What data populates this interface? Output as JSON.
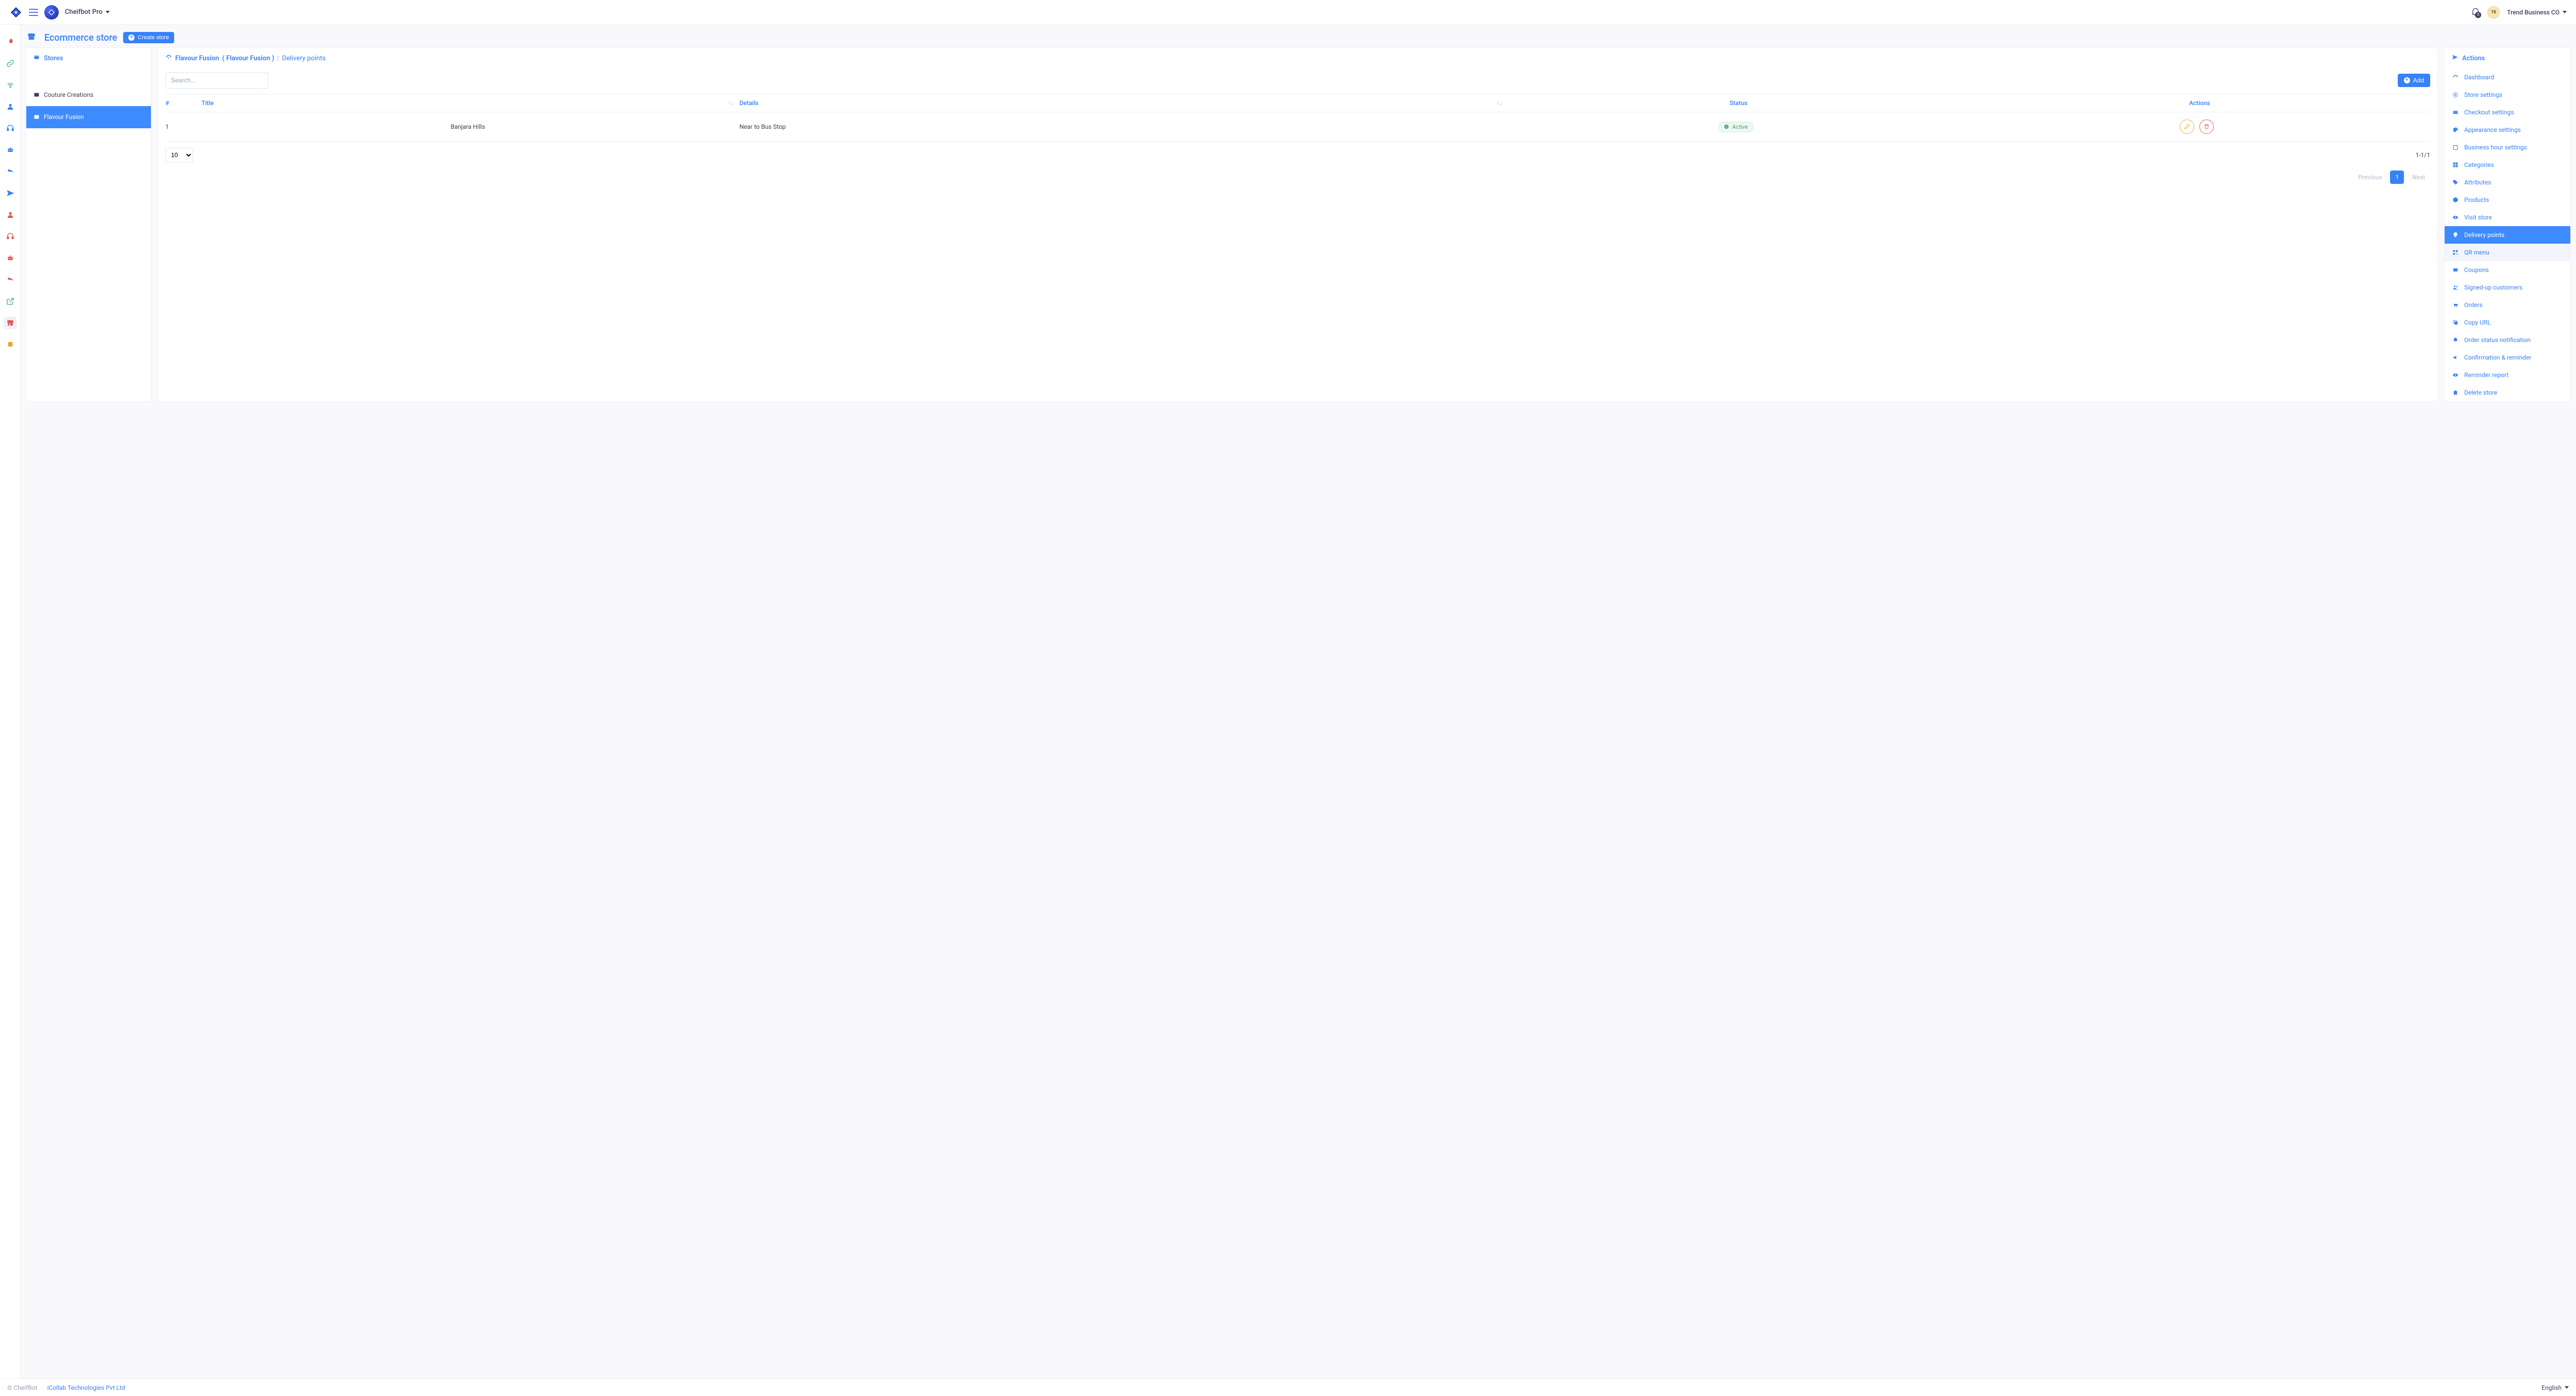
{
  "brand": {
    "name": "Cheifbot Pro"
  },
  "notifications": {
    "count": "0"
  },
  "business": {
    "name": "Trend Business CO"
  },
  "page": {
    "title": "Ecommerce store",
    "create_btn": "Create store"
  },
  "stores_panel": {
    "title": "Stores",
    "items": [
      {
        "label": "Couture Creations",
        "active": false
      },
      {
        "label": "Flavour Fusion",
        "active": true
      }
    ]
  },
  "breadcrumb": {
    "store_name": "Flavour Fusion",
    "store_paren": "( Flavour Fusion )",
    "sep": " : ",
    "section": "Delivery points"
  },
  "search": {
    "placeholder": "Search..."
  },
  "add_btn": "Add",
  "table": {
    "headers": {
      "num": "#",
      "title": "Title",
      "details": "Details",
      "status": "Status",
      "actions": "Actions"
    },
    "rows": [
      {
        "num": "1",
        "title": "Banjara Hills",
        "details": "Near to Bus Stop",
        "status_label": "Active"
      }
    ],
    "page_size": "10",
    "range": "1-1/1",
    "pager": {
      "prev": "Previous",
      "current": "1",
      "next": "Next"
    }
  },
  "actions_panel": {
    "title": "Actions",
    "items": [
      {
        "key": "dashboard",
        "label": "Dashboard",
        "icon": "gauge"
      },
      {
        "key": "store-settings",
        "label": "Store settings",
        "icon": "gear"
      },
      {
        "key": "checkout-settings",
        "label": "Checkout settings",
        "icon": "card"
      },
      {
        "key": "appearance-settings",
        "label": "Appearance settings",
        "icon": "palette"
      },
      {
        "key": "business-hour-settings",
        "label": "Business hour settings",
        "icon": "clock-list"
      },
      {
        "key": "categories",
        "label": "Categories",
        "icon": "grid"
      },
      {
        "key": "attributes",
        "label": "Attributes",
        "icon": "tags"
      },
      {
        "key": "products",
        "label": "Products",
        "icon": "cube"
      },
      {
        "key": "visit-store",
        "label": "Visit store",
        "icon": "eye"
      },
      {
        "key": "delivery-points",
        "label": "Delivery points",
        "icon": "pin",
        "active": true
      },
      {
        "key": "qr-menu",
        "label": "QR menu",
        "icon": "qr",
        "hover": true
      },
      {
        "key": "coupons",
        "label": "Coupons",
        "icon": "ticket"
      },
      {
        "key": "signed-up-customers",
        "label": "Signed-up customers",
        "icon": "users"
      },
      {
        "key": "orders",
        "label": "Orders",
        "icon": "cart"
      },
      {
        "key": "copy-url",
        "label": "Copy URL",
        "icon": "copy"
      },
      {
        "key": "order-status-notification",
        "label": "Order status notification",
        "icon": "bell"
      },
      {
        "key": "confirmation-reminder",
        "label": "Confirmation & reminder",
        "icon": "mega"
      },
      {
        "key": "reminder-report",
        "label": "Reminder report",
        "icon": "eye"
      },
      {
        "key": "delete-store",
        "label": "Delete store",
        "icon": "trash"
      }
    ]
  },
  "footer": {
    "copyright": "© CheifBot",
    "link": "iCollab Technologies Pvt Ltd",
    "lang": "English"
  }
}
